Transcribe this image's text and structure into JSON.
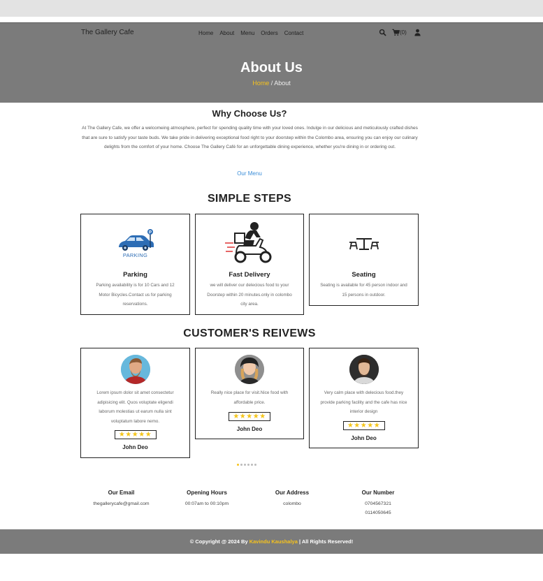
{
  "nav": {
    "brand": "The Gallery Cafe",
    "links": [
      "Home",
      "About",
      "Menu",
      "Orders",
      "Contact"
    ],
    "cart_count": "(0)",
    "icons": [
      "search-icon",
      "cart-icon",
      "user-icon"
    ]
  },
  "hero": {
    "title": "About Us",
    "crumb_home": "Home",
    "crumb_sep": " / ",
    "crumb_current": "About"
  },
  "why": {
    "title": "Why Choose Us?",
    "text": "At The Gallery Cafe, we offer a welcomeing atmosphere, perfect for spending quality time with your loved ones. Indulge in our delicious and meticulously crafted dishes that are sure to satisfy your taste buds. We take pride in delivering exceptional food right to your doorstep within the Colombo area, ensuring you can enjoy our culinary delights from the comfort of your home. Choose The Gallery Café for an unforgettable dining experience, whether you're dining in or ordering out.",
    "menu_link": "Our Menu"
  },
  "steps": {
    "title": "SIMPLE STEPS",
    "items": [
      {
        "title": "Parking",
        "text": "Parking availability is for 10 Cars and 12 Motor Bicycles.Contact us for parking reservations.",
        "icon": "car-parking-icon",
        "icon_label": "PARKING"
      },
      {
        "title": "Fast Delivery",
        "text": "we will deliver our delecious food to your Doorstep within 20 minutes.only in colombo city area.",
        "icon": "delivery-scooter-icon"
      },
      {
        "title": "Seating",
        "text": "Seating is available for 45 person indoor and 15 persons in outdoor.",
        "icon": "table-seating-icon"
      }
    ]
  },
  "reviews": {
    "title": "CUSTOMER'S REIVEWS",
    "items": [
      {
        "text": "Lorem ipsum dolor sit amet consectetur adipisicing elit. Quos voluptate eligendi laborum molestias ut earum nulla sint voluptatum labore nemo.",
        "stars": "★★★★★",
        "name": "John Deo"
      },
      {
        "text": "Really nice place for visit.Nice food with affordable price.",
        "stars": "★★★★★",
        "name": "John Deo"
      },
      {
        "text": "Very calm place with delecious food.they provide parking facility and the cafe has nice interior design",
        "stars": "★★★★★",
        "name": "John Deo"
      }
    ],
    "dots_count": 6,
    "active_dot": 0
  },
  "info": {
    "email_h": "Our Email",
    "email": "thegallerycafe@gmail.com",
    "hours_h": "Opening Hours",
    "hours": "00:07am to 00:10pm",
    "address_h": "Our Address",
    "address": "colombo",
    "number_h": "Our Number",
    "number1": "0704567321",
    "number2": "0114050645"
  },
  "footer": {
    "pre": "© Copyright @ 2024 By ",
    "author": "Kavindu Kaushalya",
    "post": " | All Rights Reserved!"
  },
  "colors": {
    "accent": "#f7c31c",
    "link": "#3b8ed8",
    "bar": "#7b7b7b"
  }
}
